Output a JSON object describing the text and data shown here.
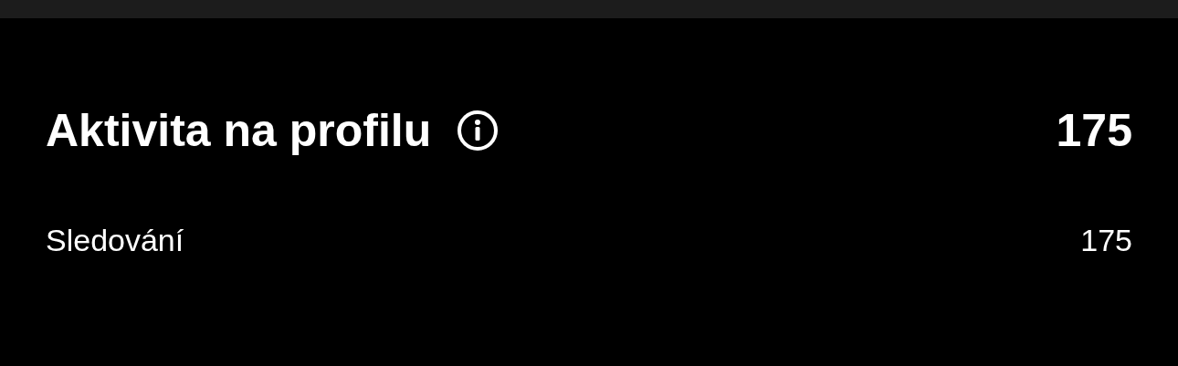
{
  "section": {
    "title": "Aktivita na profilu",
    "total": "175"
  },
  "rows": [
    {
      "label": "Sledování",
      "value": "175"
    }
  ]
}
